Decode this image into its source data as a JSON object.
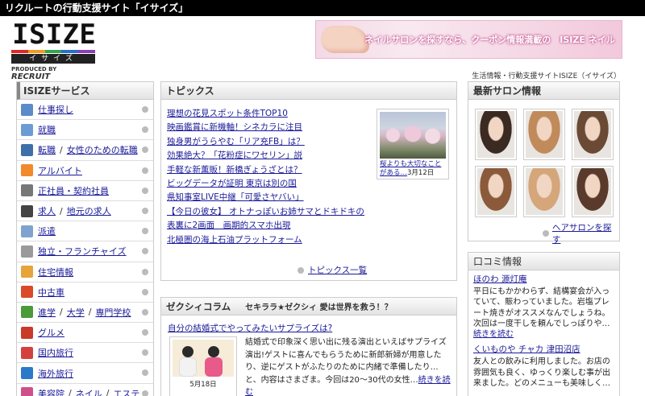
{
  "header": {
    "title": "リクルートの行動支援サイト「イサイズ」"
  },
  "logo": {
    "letters": [
      "I",
      "S",
      "I",
      "Z",
      "E"
    ],
    "kana": "イサイズ",
    "produced_by": "PRODUCED BY",
    "brand": "RECRUIT"
  },
  "banner": {
    "text": "ネイルサロンを探すなら、クーポン情報満載の　ISIZE ネイルサロン"
  },
  "tagline": "生活情報・行動支援サイトISIZE（イサイズ）",
  "services": {
    "title": "ISIZEサービス",
    "items": [
      {
        "links": [
          "仕事探し"
        ],
        "color": "#5b8bc8"
      },
      {
        "links": [
          "就職"
        ],
        "color": "#6d9bd3"
      },
      {
        "links": [
          "転職",
          "女性のための転職"
        ],
        "color": "#3e6fa8"
      },
      {
        "links": [
          "アルバイト"
        ],
        "color": "#f08a2c"
      },
      {
        "links": [
          "正社員・契約社員"
        ],
        "color": "#777777"
      },
      {
        "links": [
          "求人",
          "地元の求人"
        ],
        "color": "#444444"
      },
      {
        "links": [
          "派遣"
        ],
        "color": "#7fa3cf"
      },
      {
        "links": [
          "独立・フランチャイズ"
        ],
        "color": "#9a9a9a"
      },
      {
        "links": [
          "住宅情報"
        ],
        "color": "#e6a43a"
      },
      {
        "links": [
          "中古車"
        ],
        "color": "#d94a2a"
      },
      {
        "links": [
          "進学",
          "大学",
          "専門学校"
        ],
        "color": "#4a9a3a"
      },
      {
        "links": [
          "グルメ"
        ],
        "color": "#c83a2a"
      },
      {
        "links": [
          "国内旅行"
        ],
        "color": "#d44040"
      },
      {
        "links": [
          "海外旅行"
        ],
        "color": "#2a7ac8"
      },
      {
        "links": [
          "美容院",
          "ネイル",
          "エステ"
        ],
        "color": "#d0508a"
      }
    ]
  },
  "topics": {
    "title": "トピックス",
    "items": [
      "理想の花見スポット条件TOP10",
      "映画鑑賞に新機軸！シネカラに注目",
      "独身男がうらやむ「リア充FB」は？",
      "効果絶大？「花粉症にワセリン」説",
      "手軽な新薫販！新橋ぎょうざとは？",
      "ビッグデータが証明 東京は別の国",
      "県知事室LIVE中継「可愛さヤバい」",
      "【今日の彼女】 オトナっぽいお姉サマとドキドキのデート!?★「石川満里子」",
      "表裏に2画面　画期的スマホ出現",
      "北極圏の海上石油プラットフォーム"
    ],
    "photo_caption": "桜よりも大切なことがある…",
    "photo_date": "3月12日",
    "more_label": "トピックス一覧"
  },
  "column": {
    "title": "ゼクシィコラム",
    "subtitle": "セキララ★ゼクシィ 愛は世界を救う！？",
    "link": "自分の結婚式でやってみたいサプライズは?",
    "date": "5月18日",
    "text": "結婚式で印象深く思い出に残る演出といえばサプライズ演出!ゲストに喜んでもらうために新郎新婦が用意したり、逆にゲストがふたりのために内緒で準備したり…と、内容はさまざま。今回は20～30代の女性…",
    "more_label": "続きを読む"
  },
  "salon": {
    "title": "最新サロン情報",
    "photos": [
      "#3a2a22",
      "#c08a5a",
      "#6a4a34",
      "#8a5a3a",
      "#d4a67a",
      "#5a3a2a"
    ],
    "more_label": "ヘアサロンを探す"
  },
  "reviews": {
    "title": "口コミ情報",
    "items": [
      {
        "name": "ほのわ 源灯庵",
        "text": "平日にもかかわらず、結構宴会が入っていて、賑わっていました。岩塩プレート焼きがオススメなんでしょうね。次回は一度干しを頼んでしっぽりや…",
        "more": "続きを読む"
      },
      {
        "name": "くいものや チャカ 津田沼店",
        "text": "友人との飲みに利用しました。お店の雰囲気も良く、ゆっくり楽しむ事が出来ました。どのメニューも美味しく…",
        "more": ""
      }
    ]
  }
}
